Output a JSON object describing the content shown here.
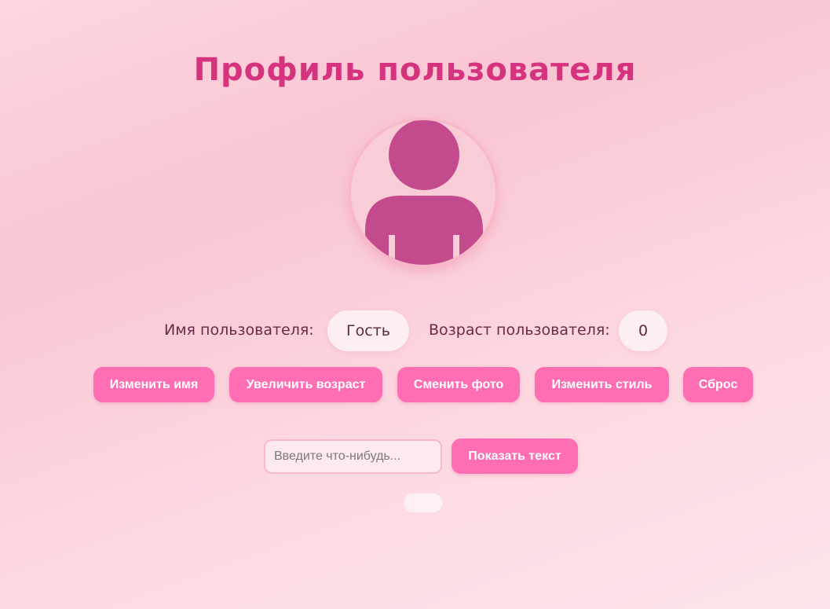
{
  "title": "Профиль пользователя",
  "avatar": {
    "icon": "user-silhouette-icon"
  },
  "info": {
    "name_label": "Имя пользователя:",
    "name_value": "Гость",
    "age_label": "Возраст пользователя:",
    "age_value": "0"
  },
  "buttons": {
    "change_name": "Изменить имя",
    "increase_age": "Увеличить возраст",
    "change_photo": "Сменить фото",
    "change_style": "Изменить стиль",
    "reset": "Сброс"
  },
  "text_input": {
    "placeholder": "Введите что-нибудь...",
    "value": ""
  },
  "show_text_button": "Показать текст",
  "output_text": "",
  "colors": {
    "accent": "#ff6db2",
    "title": "#d6337f",
    "avatar_figure": "#c44a8e"
  }
}
